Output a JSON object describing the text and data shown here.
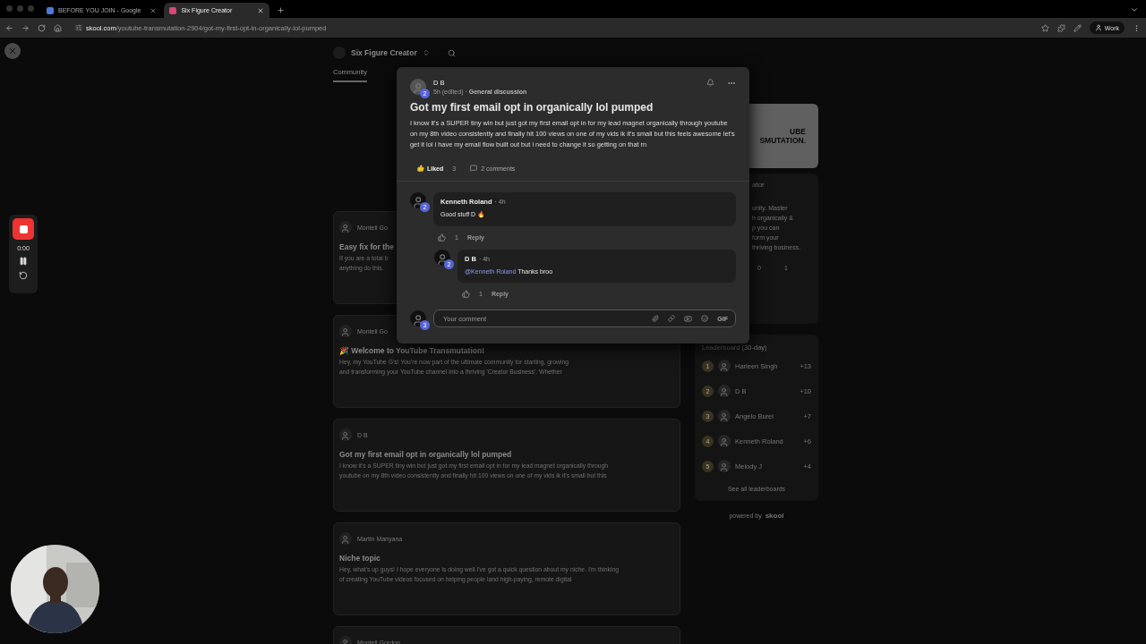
{
  "browser": {
    "tabs": [
      {
        "title": "BEFORE YOU JOIN - Google",
        "selected": false
      },
      {
        "title": "Six Figure Creator",
        "selected": true
      }
    ],
    "url_host": "skool.com",
    "url_path": "/youtube-transmutation-2904/got-my-first-opt-in-organically-lol-pumped",
    "profile": "Work"
  },
  "recorder": {
    "time": "0:00"
  },
  "community": {
    "name": "Six Figure Creator",
    "tabs": [
      {
        "label": "Community",
        "selected": true
      }
    ],
    "posts": [
      {
        "author": "Montell Go",
        "title": "Easy fix for the",
        "body": [
          "If you are a total b",
          "anything do this."
        ]
      },
      {
        "author": "Montell Go",
        "title": "🎉 Welcome to YouTube Transmutation!",
        "body": [
          "Hey, my YouTube G's! You're now part of the ultimate community for starting, growing",
          "and transforming your YouTube channel into a thriving 'Creator Business'. Whether"
        ]
      },
      {
        "author": "D B",
        "title": "Got my first email opt in organically lol pumped",
        "body": [
          "I know it's a SUPER tiny win but just got my first email opt in for my lead magnet organically through",
          "youtube on my 8th video consistently and finally hit 100 views on one of my vids ik it's small but this"
        ]
      },
      {
        "author": "Martin Manyana",
        "title": "Niche topic",
        "body": [
          "Hey, what's up guys! I hope everyone is doing well.I've got a quick question about my niche. I'm thinking",
          "of creating YouTube videos focused on helping people land high-paying, remote digital"
        ]
      },
      {
        "author": "Montell Gordon"
      }
    ]
  },
  "sidebar": {
    "banner": [
      "UBE",
      "SMUTATION."
    ],
    "name": "ator",
    "about": [
      "unity. Master",
      "h organically &",
      "p you can",
      "form your",
      "thriving business."
    ],
    "stats": [
      "0",
      "1"
    ],
    "leaderboard_title": "Leaderboard (30-day)",
    "leaders": [
      {
        "rank": "1",
        "name": "Harleen Singh",
        "points": "+13"
      },
      {
        "rank": "2",
        "name": "D B",
        "points": "+10"
      },
      {
        "rank": "3",
        "name": "Angelo Burei",
        "points": "+7"
      },
      {
        "rank": "4",
        "name": "Kenneth Roland",
        "points": "+6"
      },
      {
        "rank": "5",
        "name": "Melody J",
        "points": "+4"
      }
    ],
    "see_all": "See all leaderboards",
    "powered_by": "powered by",
    "brand": "skool"
  },
  "modal": {
    "post": {
      "author": "D B",
      "level": "2",
      "meta": "5h (edited) · ",
      "category": "General discussion",
      "title": "Got my first email opt in organically lol pumped",
      "body": "I know it's a SUPER tiny win but just got my first email opt in for my lead magnet organically through youtube on my 8th video consistently and finally hit 100 views on one of my vids ik it's small but this feels awesome let's get it lol i have my email flow built out but i need to change it so getting on that rn",
      "liked": true,
      "like_label": "Liked",
      "like_count": "3",
      "comments_label": "2 comments"
    },
    "comments": [
      {
        "author": "Kenneth Roland",
        "level": "2",
        "time": "· 4h",
        "text": "Good stuff D 🔥",
        "likes": "1",
        "reply": "Reply",
        "replies": [
          {
            "author": "D B",
            "level": "2",
            "time": "· 4h",
            "mention": "@Kenneth Roland",
            "text": "Thanks broo",
            "likes": "1",
            "reply": "Reply"
          }
        ]
      }
    ],
    "composer": {
      "level": "3",
      "placeholder": "Your comment",
      "gif": "GIF"
    }
  }
}
